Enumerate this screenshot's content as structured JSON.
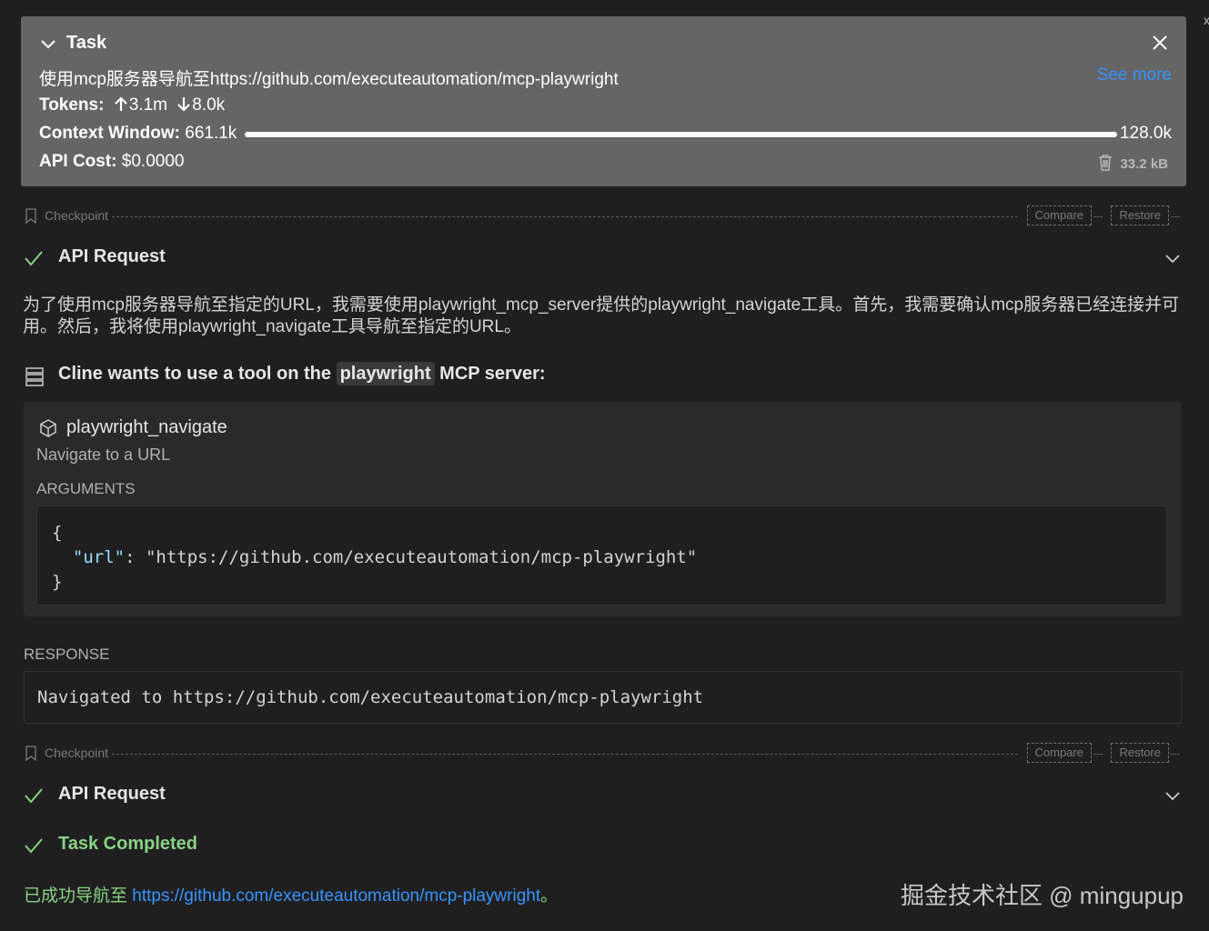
{
  "task": {
    "title": "Task",
    "description": "使用mcp服务器导航至https://github.com/executeautomation/mcp-playwright",
    "see_more": "See more",
    "tokens_label": "Tokens:",
    "tokens_in": "3.1m",
    "tokens_out": "8.0k",
    "context_label": "Context Window:",
    "context_used": "661.1k",
    "context_max": "128.0k",
    "cost_label": "API Cost:",
    "cost_value": "$0.0000",
    "storage_size": "33.2 kB"
  },
  "checkpoints": [
    {
      "label": "Checkpoint",
      "compare": "Compare",
      "restore": "Restore"
    },
    {
      "label": "Checkpoint",
      "compare": "Compare",
      "restore": "Restore"
    }
  ],
  "api_requests": [
    {
      "label": "API Request"
    },
    {
      "label": "API Request"
    }
  ],
  "reasoning_text": "为了使用mcp服务器导航至指定的URL，我需要使用playwright_mcp_server提供的playwright_navigate工具。首先，我需要确认mcp服务器已经连接并可用。然后，我将使用playwright_navigate工具导航至指定的URL。",
  "tool_request": {
    "prefix": "Cline wants to use a tool on the",
    "server": "playwright",
    "suffix": "MCP server:"
  },
  "tool": {
    "name": "playwright_navigate",
    "description": "Navigate to a URL",
    "arguments_header": "ARGUMENTS",
    "arg_open": "{",
    "arg_key": "\"url\"",
    "arg_sep": ": ",
    "arg_value": "\"https://github.com/executeautomation/mcp-playwright\"",
    "arg_close": "}"
  },
  "response": {
    "header": "RESPONSE",
    "text": "Navigated to https://github.com/executeautomation/mcp-playwright"
  },
  "completion": {
    "label": "Task Completed",
    "result_prefix": "已成功导航至 ",
    "result_link": "https://github.com/executeautomation/mcp-playwright",
    "result_suffix": "。"
  },
  "watermark": "掘金技术社区 @ mingupup",
  "icons": [
    "chevron-down-icon",
    "close-icon",
    "arrow-up-icon",
    "arrow-down-icon",
    "trash-icon",
    "bookmark-icon",
    "check-icon",
    "server-icon",
    "cube-icon"
  ],
  "colors": {
    "accent_link": "#3794ff",
    "success": "#89d185",
    "task_bg": "#656565",
    "background": "#1f1f1f"
  }
}
